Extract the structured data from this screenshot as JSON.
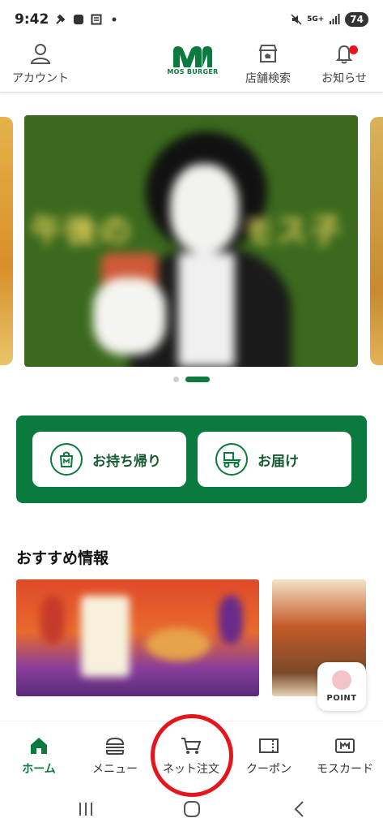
{
  "status_bar": {
    "time": "9:42",
    "network": "5G+",
    "battery": "74"
  },
  "header": {
    "account_label": "アカウント",
    "logo_text": "MOS BURGER",
    "store_search_label": "店舗検索",
    "notifications_label": "お知らせ"
  },
  "banner": {
    "headline_left": "午後の",
    "headline_right": "モス子"
  },
  "order": {
    "takeout_label": "お持ち帰り",
    "delivery_label": "お届け"
  },
  "recommended": {
    "title": "おすすめ情報"
  },
  "point_badge": {
    "label": "POINT"
  },
  "bottom_nav": {
    "home": "ホーム",
    "menu": "メニュー",
    "net_order": "ネット注文",
    "coupon": "クーポン",
    "mos_card": "モスカード"
  },
  "colors": {
    "brand_green": "#0b7a3e",
    "highlight_red": "#e6141b"
  }
}
